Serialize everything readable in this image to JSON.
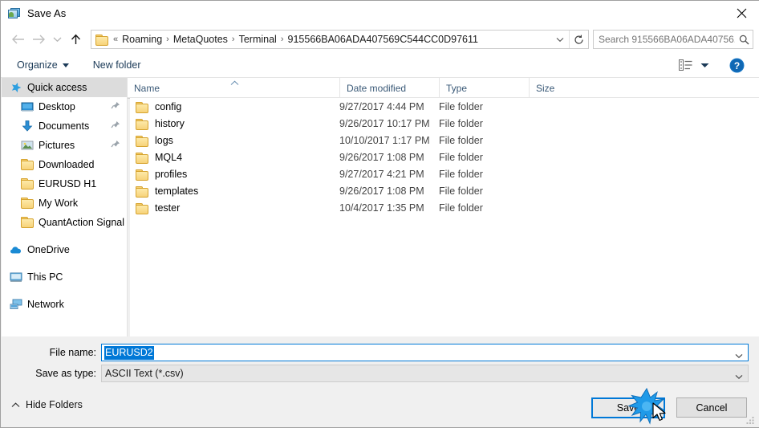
{
  "window": {
    "title": "Save As",
    "icon": "save-as-icon",
    "close_label": "✕"
  },
  "nav": {
    "back": "back-arrow",
    "forward": "forward-arrow",
    "recent": "recent-locations-chevron",
    "up": "up-arrow",
    "breadcrumbs": [
      "Roaming",
      "MetaQuotes",
      "Terminal",
      "915566BA06ADA407569C544CC0D97611"
    ],
    "breadcrumb_prefix": "«",
    "separator": "›",
    "dropdown": "address-dropdown",
    "refresh": "refresh-icon"
  },
  "search": {
    "placeholder": "Search 915566BA06ADA40756...",
    "value": "",
    "icon": "search-icon"
  },
  "toolbar": {
    "organize_label": "Organize",
    "new_folder_label": "New folder",
    "view_icon": "view-layout-icon",
    "view_caret": "chevron-down-icon",
    "help_label": "?"
  },
  "sidebar": {
    "items": [
      {
        "label": "Quick access",
        "icon": "star-pin-icon",
        "level": "root",
        "selected": true,
        "pinned": false
      },
      {
        "label": "Desktop",
        "icon": "desktop-icon",
        "level": "lvl0",
        "selected": false,
        "pinned": true
      },
      {
        "label": "Documents",
        "icon": "documents-icon",
        "level": "lvl0",
        "selected": false,
        "pinned": true
      },
      {
        "label": "Pictures",
        "icon": "pictures-icon",
        "level": "lvl0",
        "selected": false,
        "pinned": true
      },
      {
        "label": "Downloaded",
        "icon": "folder-icon",
        "level": "lvl0",
        "selected": false,
        "pinned": false
      },
      {
        "label": "EURUSD H1",
        "icon": "folder-icon",
        "level": "lvl0",
        "selected": false,
        "pinned": false
      },
      {
        "label": "My Work",
        "icon": "folder-icon",
        "level": "lvl0",
        "selected": false,
        "pinned": false
      },
      {
        "label": "QuantAction Signal",
        "icon": "folder-icon",
        "level": "lvl0",
        "selected": false,
        "pinned": false
      },
      {
        "label": "OneDrive",
        "icon": "onedrive-icon",
        "level": "root",
        "selected": false,
        "pinned": false,
        "gap_before": true
      },
      {
        "label": "This PC",
        "icon": "this-pc-icon",
        "level": "root",
        "selected": false,
        "pinned": false,
        "gap_before": true
      },
      {
        "label": "Network",
        "icon": "network-icon",
        "level": "root",
        "selected": false,
        "pinned": false,
        "gap_before": true
      }
    ]
  },
  "filelist": {
    "columns": [
      "Name",
      "Date modified",
      "Type",
      "Size"
    ],
    "sort_column": "Name",
    "sort_direction": "ascending",
    "rows": [
      {
        "name": "config",
        "date": "9/27/2017 4:44 PM",
        "type": "File folder",
        "size": ""
      },
      {
        "name": "history",
        "date": "9/26/2017 10:17 PM",
        "type": "File folder",
        "size": ""
      },
      {
        "name": "logs",
        "date": "10/10/2017 1:17 PM",
        "type": "File folder",
        "size": ""
      },
      {
        "name": "MQL4",
        "date": "9/26/2017 1:08 PM",
        "type": "File folder",
        "size": ""
      },
      {
        "name": "profiles",
        "date": "9/27/2017 4:21 PM",
        "type": "File folder",
        "size": ""
      },
      {
        "name": "templates",
        "date": "9/26/2017 1:08 PM",
        "type": "File folder",
        "size": ""
      },
      {
        "name": "tester",
        "date": "10/4/2017 1:35 PM",
        "type": "File folder",
        "size": ""
      }
    ]
  },
  "form": {
    "filename_label": "File name:",
    "filename_value": "EURUSD2",
    "filename_selected": true,
    "filetype_label": "Save as type:",
    "filetype_value": "ASCII Text (*.csv)"
  },
  "footer": {
    "hide_folders_label": "Hide Folders",
    "hide_folders_icon": "chevron-up-icon",
    "save_label": "Save",
    "cancel_label": "Cancel",
    "resize_grip": "resize-grip-icon"
  },
  "pointer": {
    "click_effect": "click-burst",
    "cursor": "arrow-cursor"
  },
  "colors": {
    "accent": "#0078d7",
    "folder": "#f7d37a",
    "selection": "#dcdcdc",
    "header_text": "#3b5a78",
    "toolbar_text": "#1b3a57"
  }
}
